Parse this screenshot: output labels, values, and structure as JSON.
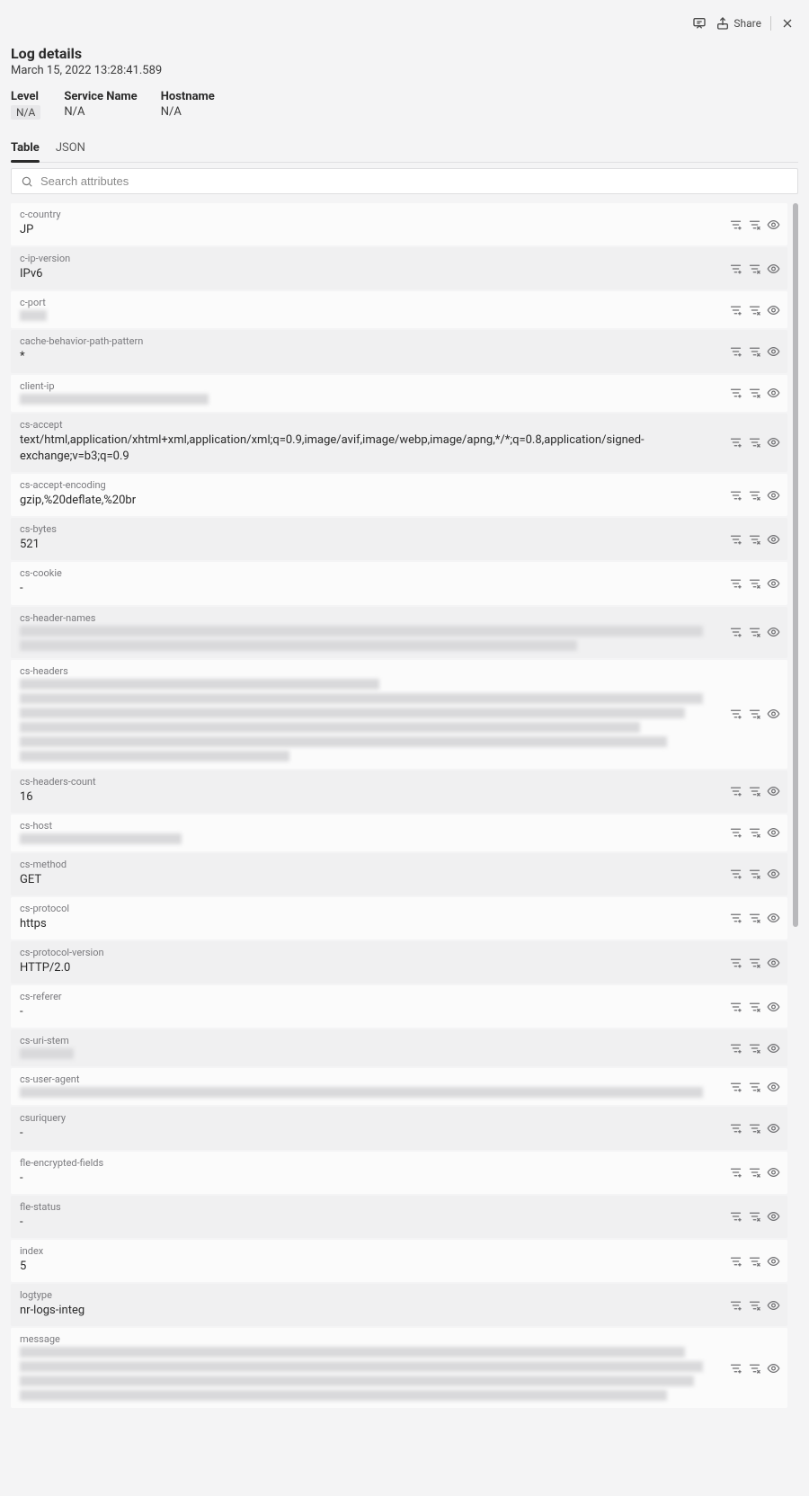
{
  "toolbar": {
    "share_label": "Share"
  },
  "header": {
    "title": "Log details",
    "timestamp": "March 15, 2022 13:28:41.589"
  },
  "meta": {
    "level_label": "Level",
    "level_value": "N/A",
    "service_label": "Service Name",
    "service_value": "N/A",
    "host_label": "Hostname",
    "host_value": "N/A"
  },
  "tabs": {
    "table_label": "Table",
    "json_label": "JSON"
  },
  "search": {
    "placeholder": "Search attributes"
  },
  "attributes": [
    {
      "key": "c-country",
      "value": "JP",
      "shade": "light",
      "redacted": false
    },
    {
      "key": "c-ip-version",
      "value": "IPv6",
      "shade": "dark",
      "redacted": false
    },
    {
      "key": "c-port",
      "value": "",
      "shade": "light",
      "redacted": true,
      "redactWidths": [
        30
      ]
    },
    {
      "key": "cache-behavior-path-pattern",
      "value": "*",
      "shade": "dark",
      "redacted": false
    },
    {
      "key": "client-ip",
      "value": "",
      "shade": "light",
      "redacted": true,
      "redactWidths": [
        210
      ]
    },
    {
      "key": "cs-accept",
      "value": "text/html,application/xhtml+xml,application/xml;q=0.9,image/avif,image/webp,image/apng,*/*;q=0.8,application/signed-exchange;v=b3;q=0.9",
      "shade": "dark",
      "redacted": false
    },
    {
      "key": "cs-accept-encoding",
      "value": "gzip,%20deflate,%20br",
      "shade": "light",
      "redacted": false
    },
    {
      "key": "cs-bytes",
      "value": "521",
      "shade": "dark",
      "redacted": false
    },
    {
      "key": "cs-cookie",
      "value": "-",
      "shade": "light",
      "redacted": false
    },
    {
      "key": "cs-header-names",
      "value": "",
      "shade": "dark",
      "redacted": true,
      "redactWidths": [
        760,
        620
      ]
    },
    {
      "key": "cs-headers",
      "value": "",
      "shade": "light",
      "redacted": true,
      "redactWidths": [
        400,
        760,
        740,
        690,
        720,
        300
      ]
    },
    {
      "key": "cs-headers-count",
      "value": "16",
      "shade": "dark",
      "redacted": false
    },
    {
      "key": "cs-host",
      "value": "",
      "shade": "light",
      "redacted": true,
      "redactWidths": [
        180
      ]
    },
    {
      "key": "cs-method",
      "value": "GET",
      "shade": "dark",
      "redacted": false
    },
    {
      "key": "cs-protocol",
      "value": "https",
      "shade": "light",
      "redacted": false
    },
    {
      "key": "cs-protocol-version",
      "value": "HTTP/2.0",
      "shade": "dark",
      "redacted": false
    },
    {
      "key": "cs-referer",
      "value": "-",
      "shade": "light",
      "redacted": false
    },
    {
      "key": "cs-uri-stem",
      "value": "",
      "shade": "dark",
      "redacted": true,
      "redactWidths": [
        60
      ]
    },
    {
      "key": "cs-user-agent",
      "value": "",
      "shade": "light",
      "redacted": true,
      "redactWidths": [
        760
      ]
    },
    {
      "key": "csuriquery",
      "value": "-",
      "shade": "dark",
      "redacted": false
    },
    {
      "key": "fle-encrypted-fields",
      "value": "-",
      "shade": "light",
      "redacted": false
    },
    {
      "key": "fle-status",
      "value": "-",
      "shade": "dark",
      "redacted": false
    },
    {
      "key": "index",
      "value": "5",
      "shade": "light",
      "redacted": false
    },
    {
      "key": "logtype",
      "value": "nr-logs-integ",
      "shade": "dark",
      "redacted": false
    },
    {
      "key": "message",
      "value": "",
      "shade": "light",
      "redacted": true,
      "redactWidths": [
        740,
        760,
        750,
        720
      ]
    }
  ]
}
